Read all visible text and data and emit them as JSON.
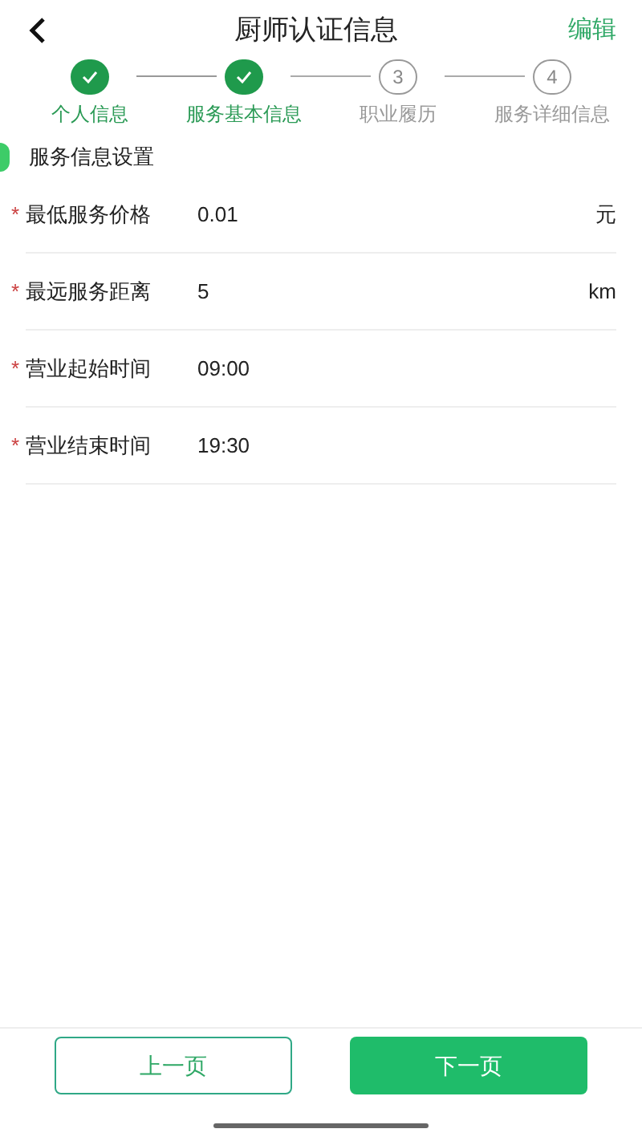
{
  "header": {
    "title": "厨师认证信息",
    "action": "编辑"
  },
  "steps": [
    {
      "label": "个人信息",
      "done": true
    },
    {
      "label": "服务基本信息",
      "done": true
    },
    {
      "label": "职业履历",
      "number": "3",
      "done": false
    },
    {
      "label": "服务详细信息",
      "number": "4",
      "done": false
    }
  ],
  "section": {
    "title": "服务信息设置"
  },
  "fields": [
    {
      "required_mark": "*",
      "label": "最低服务价格",
      "value": "0.01",
      "unit": "元"
    },
    {
      "required_mark": "*",
      "label": "最远服务距离",
      "value": "5",
      "unit": "km"
    },
    {
      "required_mark": "*",
      "label": "营业起始时间",
      "value": "09:00"
    },
    {
      "required_mark": "*",
      "label": "营业结束时间",
      "value": "19:30"
    }
  ],
  "buttons": {
    "prev": "上一页",
    "next": "下一页"
  }
}
